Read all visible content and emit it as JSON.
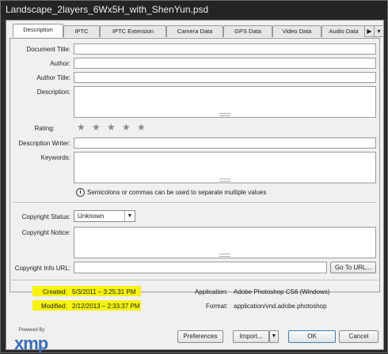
{
  "window": {
    "title": "Landscape_2layers_6Wx5H_with_ShenYun.psd"
  },
  "tabs": [
    "Description",
    "IPTC",
    "IPTC Extension",
    "Camera Data",
    "GPS Data",
    "Video Data",
    "Audio Data"
  ],
  "active_tab": "Description",
  "form": {
    "doc_title_label": "Document Title:",
    "author_label": "Author:",
    "author_title_label": "Author Title:",
    "description_label": "Description:",
    "rating_label": "Rating:",
    "rating_value": 0,
    "rating_max": 5,
    "desc_writer_label": "Description Writer:",
    "keywords_label": "Keywords:",
    "keywords_note": "Semicolons or commas can be used to separate multiple values",
    "copyright_status_label": "Copyright Status:",
    "copyright_status_value": "Unknown",
    "copyright_notice_label": "Copyright Notice:",
    "copyright_url_label": "Copyright Info URL:",
    "goto_url_button": "Go To URL..."
  },
  "footer": {
    "created_label": "Created:",
    "created_value": "5/3/2011 – 3:25:31 PM",
    "modified_label": "Modified:",
    "modified_value": "2/12/2013 – 2:33:37 PM",
    "application_label": "Application:",
    "application_value": "Adobe Photoshop CS6 (Windows)",
    "format_label": "Format:",
    "format_value": "application/vnd.adobe.photoshop",
    "highlight_color": "#f7f210"
  },
  "buttons": {
    "preferences": "Preferences",
    "import": "Import...",
    "ok": "OK",
    "cancel": "Cancel"
  },
  "logo": {
    "powered_by": "Powered By",
    "name": "xmp"
  }
}
